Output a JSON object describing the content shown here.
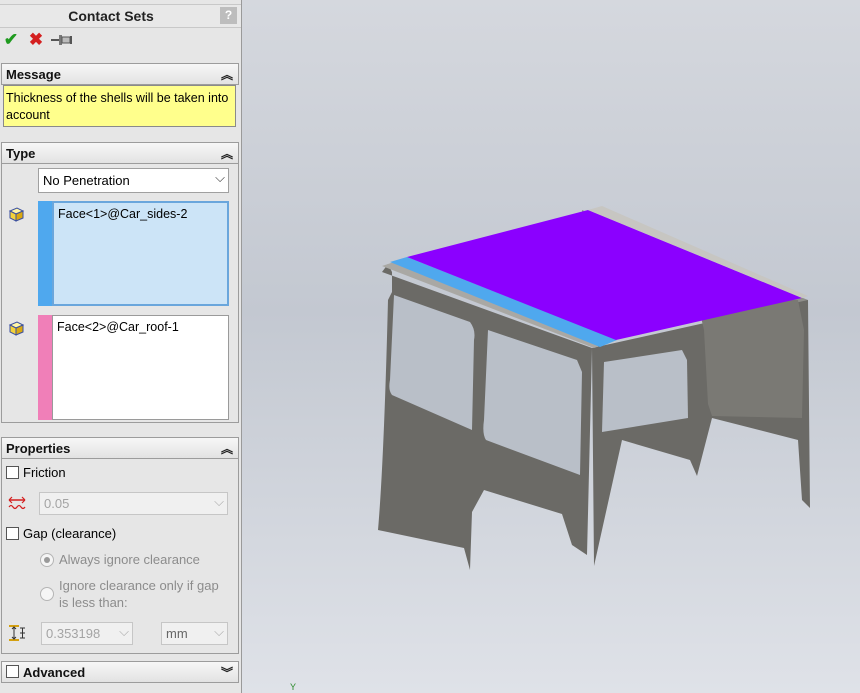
{
  "panel": {
    "title": "Contact Sets",
    "help_glyph": "?",
    "toolbar": {
      "ok": "✔",
      "cancel": "✖",
      "pin": "⊣"
    },
    "message": {
      "header": "Message",
      "text": "Thickness of the shells will be taken into account"
    },
    "type": {
      "header": "Type",
      "selected": "No Penetration",
      "set1": {
        "face": "Face<1>@Car_sides-2",
        "color": "#4fa8ee"
      },
      "set2": {
        "face": "Face<2>@Car_roof-1",
        "color": "#f07fb8"
      }
    },
    "properties": {
      "header": "Properties",
      "friction_label": "Friction",
      "friction_value": "0.05",
      "gap_label": "Gap (clearance)",
      "option_always": "Always ignore clearance",
      "option_ignore_line1": "Ignore clearance only if gap",
      "option_ignore_line2": "is less than:",
      "gap_value": "0.353198",
      "unit": "mm"
    },
    "advanced": {
      "header": "Advanced"
    }
  },
  "viewport": {
    "axis_label": "Y",
    "roof_color": "#8b00ff",
    "strip_color": "#4fa8ee",
    "body_color": "#6b6a66"
  }
}
